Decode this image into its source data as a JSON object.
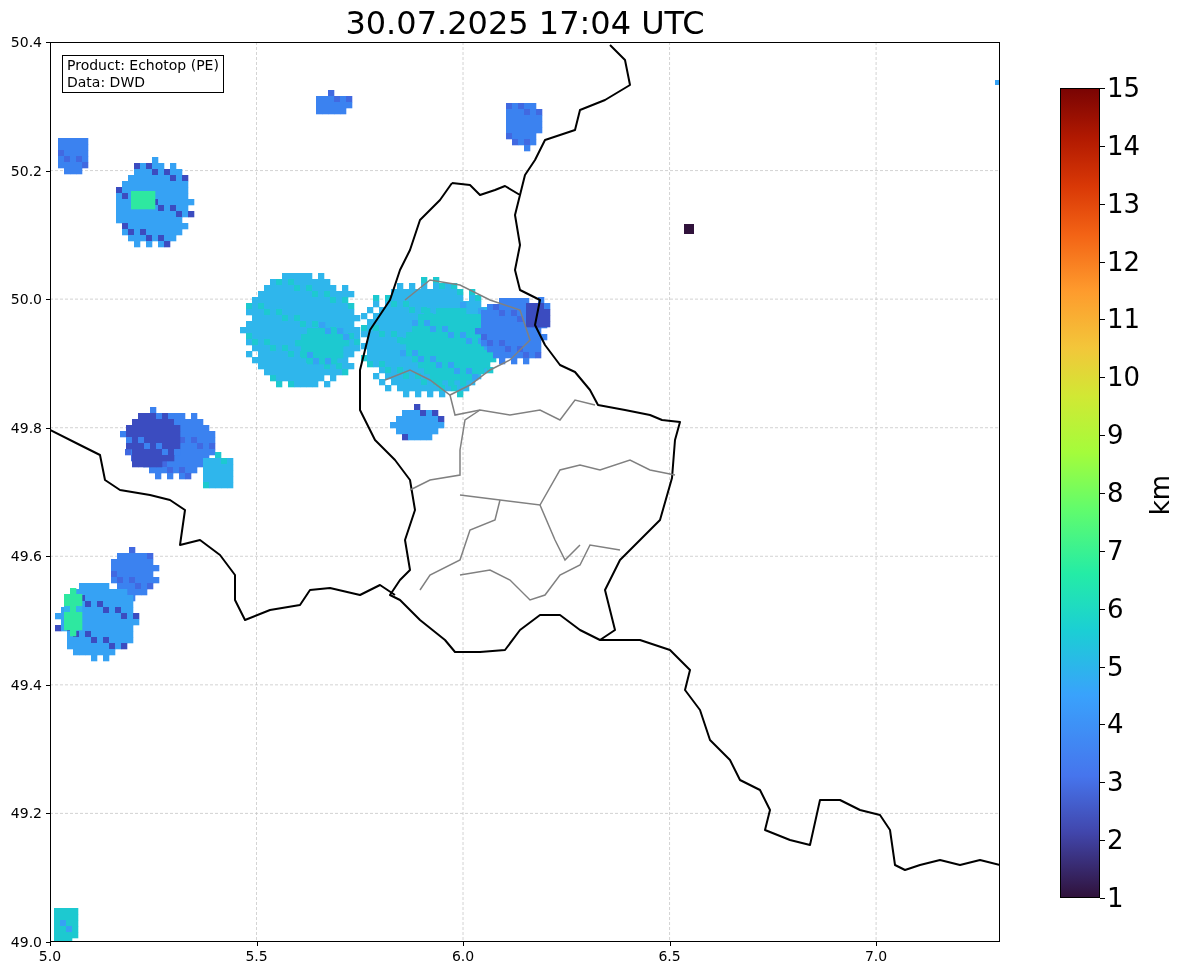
{
  "title": "30.07.2025 17:04 UTC",
  "info_box": {
    "lines": [
      "Product: Echotop (PE)",
      "Data: DWD"
    ]
  },
  "map": {
    "x_ticks": [
      "5.0",
      "5.5",
      "6.0",
      "6.5",
      "7.0"
    ],
    "y_ticks": [
      "50.4",
      "50.2",
      "50.0",
      "49.8",
      "49.6",
      "49.4",
      "49.2",
      "49.0"
    ]
  },
  "colorbar": {
    "label": "km",
    "ticks": [
      "15",
      "14",
      "13",
      "12",
      "11",
      "10",
      "9",
      "8",
      "7",
      "6",
      "5",
      "4",
      "3",
      "2",
      "1"
    ]
  }
}
